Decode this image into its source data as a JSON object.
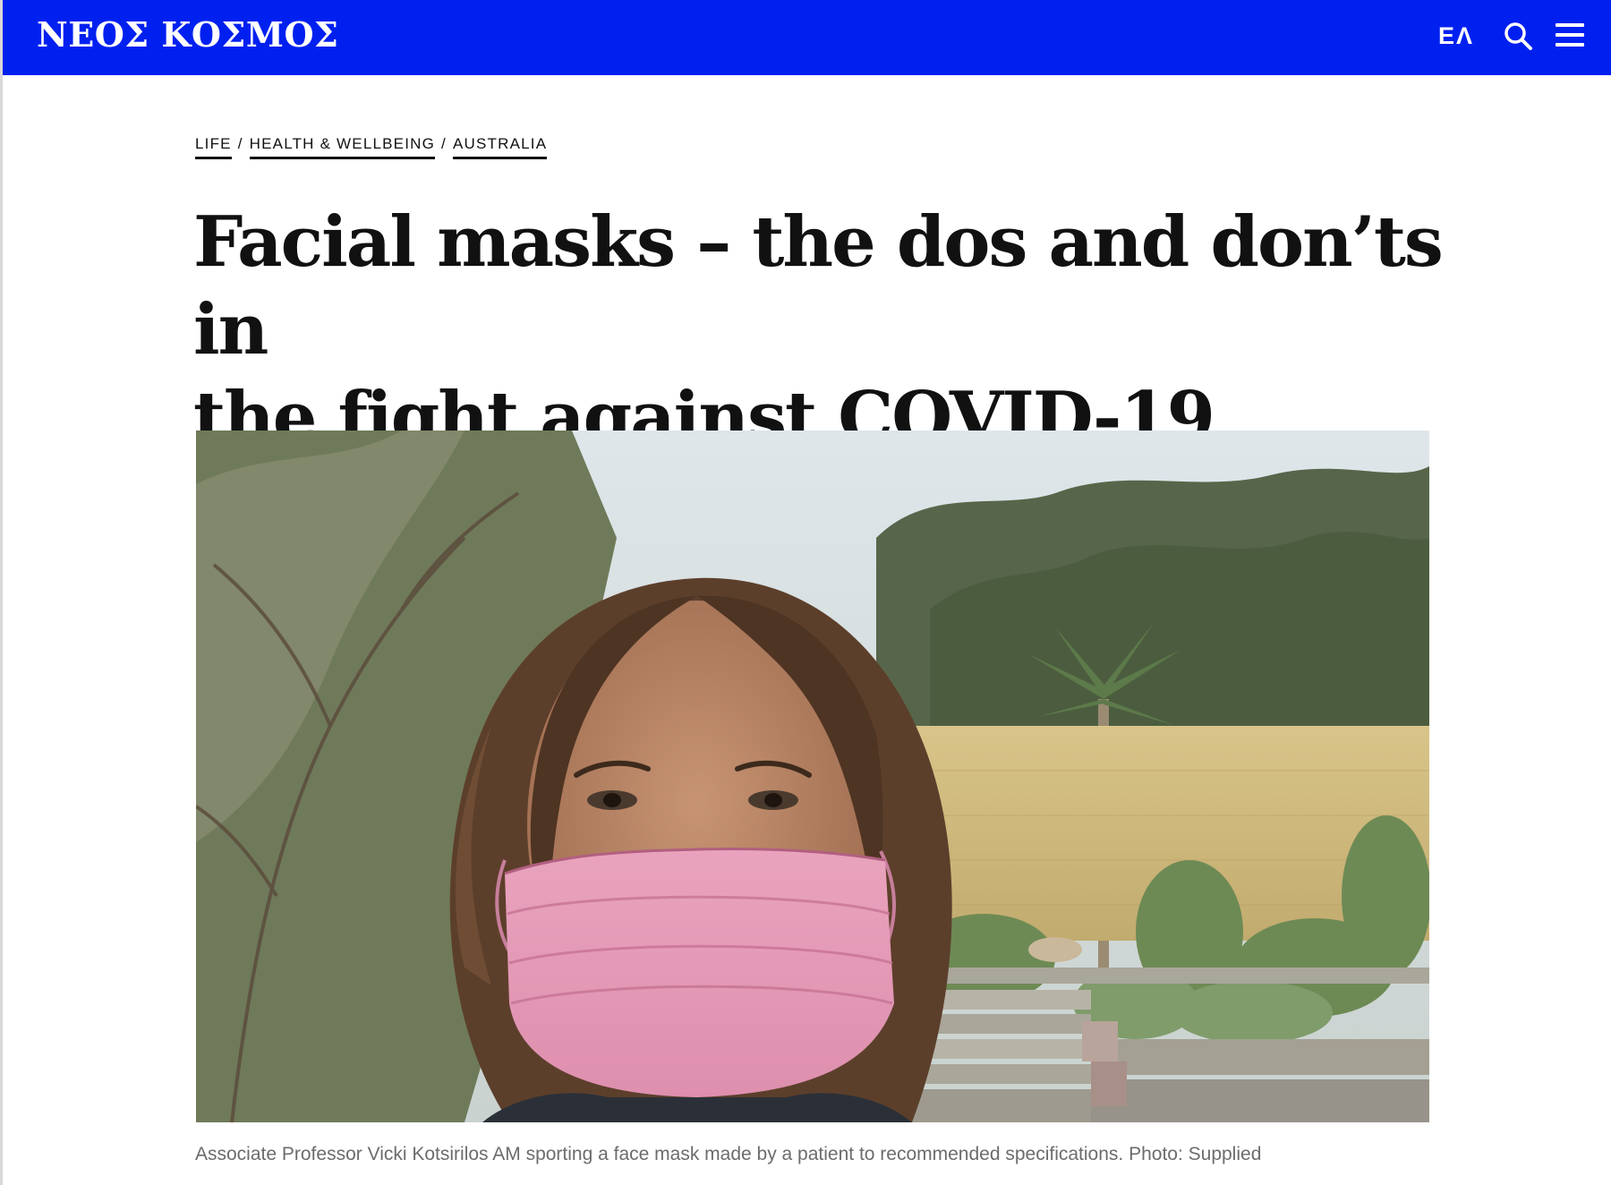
{
  "header": {
    "logo": "ΝΕΟΣ ΚΟΣΜΟΣ",
    "language_toggle": "ΕΛ",
    "search_icon": "search-icon",
    "menu_icon": "hamburger-menu-icon",
    "background_color": "#0020f0"
  },
  "breadcrumb": {
    "items": [
      {
        "label": "LIFE"
      },
      {
        "label": "HEALTH & WELLBEING"
      },
      {
        "label": "AUSTRALIA"
      }
    ],
    "separator": "/"
  },
  "article": {
    "headline_line1": "Facial masks – the dos and don’ts in",
    "headline_line2": "the fight against COVID-19",
    "image_caption": "Associate Professor Vicki Kotsirilos AM sporting a face mask made by a patient to recommended specifications. Photo: Supplied"
  }
}
